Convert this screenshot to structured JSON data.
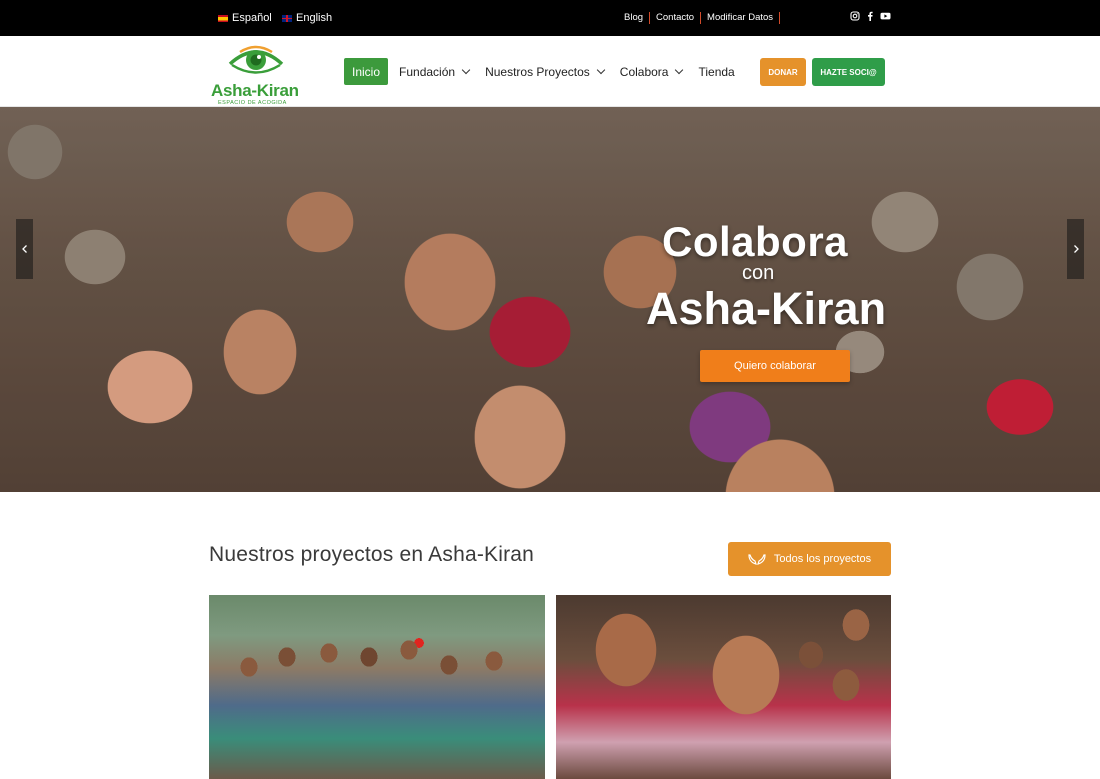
{
  "topbar": {
    "languages": [
      {
        "label": "Español",
        "flag": "flag-spain-icon"
      },
      {
        "label": "English",
        "flag": "flag-uk-icon"
      }
    ],
    "links": [
      "Blog",
      "Contacto",
      "Modificar Datos"
    ],
    "social_icons": [
      "instagram-icon",
      "facebook-icon",
      "youtube-icon"
    ]
  },
  "header": {
    "logo": {
      "name": "Asha-Kiran",
      "tagline": "ESPACIO DE ACOGIDA",
      "icon": "eye-logo-icon"
    },
    "nav": [
      {
        "label": "Inicio",
        "active": true
      },
      {
        "label": "Fundación",
        "dropdown": true
      },
      {
        "label": "Nuestros Proyectos",
        "dropdown": true
      },
      {
        "label": "Colabora",
        "dropdown": true
      },
      {
        "label": "Tienda"
      }
    ],
    "donar_label": "DONAR",
    "socio_label": "HAZTE SOCI@"
  },
  "hero": {
    "line1": "Colabora",
    "line2": "con",
    "line3": "Asha-Kiran",
    "button_label": "Quiero colaborar",
    "prev_icon": "chevron-left-icon",
    "next_icon": "chevron-right-icon"
  },
  "projects": {
    "title": "Nuestros proyectos en Asha-Kiran",
    "all_button_label": "Todos los proyectos",
    "all_button_icon": "hands-icon"
  },
  "colors": {
    "topbar": "#000000",
    "green": "#3c9a3c",
    "orange": "#e5922b",
    "hero_button": "#f07e1a"
  }
}
